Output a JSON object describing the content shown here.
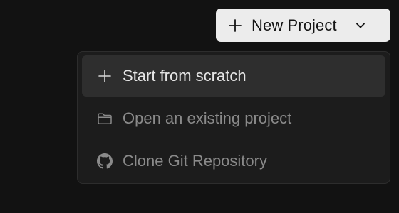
{
  "header": {
    "new_project_label": "New Project"
  },
  "menu": {
    "items": [
      {
        "label": "Start from scratch",
        "icon": "plus-icon",
        "highlighted": true
      },
      {
        "label": "Open an existing project",
        "icon": "folder-icon",
        "highlighted": false
      },
      {
        "label": "Clone Git Repository",
        "icon": "github-icon",
        "highlighted": false
      }
    ]
  },
  "colors": {
    "background": "#121212",
    "button_bg": "#ececec",
    "menu_bg": "#1c1c1c",
    "highlight_bg": "#2e2e2e"
  }
}
